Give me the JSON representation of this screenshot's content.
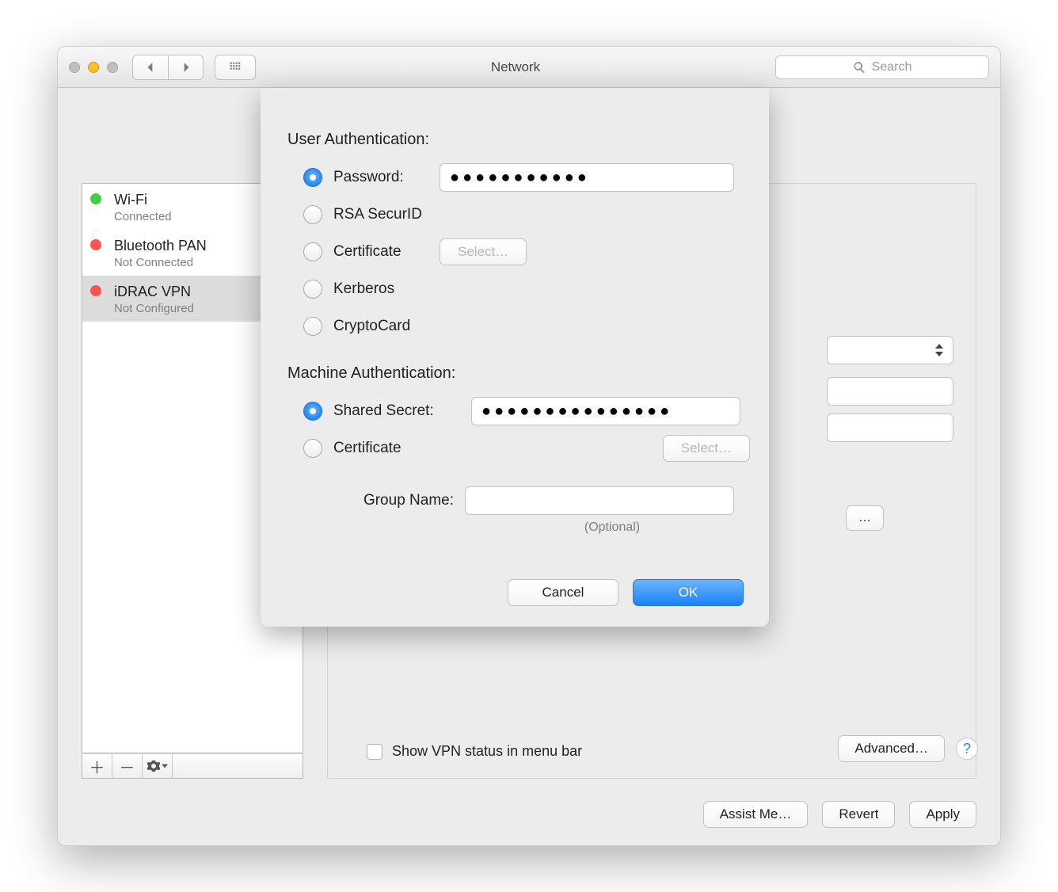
{
  "window": {
    "title": "Network",
    "search_placeholder": "Search"
  },
  "sidebar": {
    "services": [
      {
        "name": "Wi-Fi",
        "status": "Connected",
        "color": "green",
        "selected": false
      },
      {
        "name": "Bluetooth PAN",
        "status": "Not Connected",
        "color": "redb",
        "selected": false
      },
      {
        "name": "iDRAC VPN",
        "status": "Not Configured",
        "color": "redb",
        "selected": true
      }
    ]
  },
  "rightpane": {
    "show_vpn_label": "Show VPN status in menu bar",
    "advanced_label": "Advanced…",
    "help_label": "?"
  },
  "footer": {
    "assist": "Assist Me…",
    "revert": "Revert",
    "apply": "Apply"
  },
  "sheet": {
    "user_auth_heading": "User Authentication:",
    "user_options": [
      {
        "label": "Password:",
        "checked": true
      },
      {
        "label": "RSA SecurID",
        "checked": false
      },
      {
        "label": "Certificate",
        "checked": false
      },
      {
        "label": "Kerberos",
        "checked": false
      },
      {
        "label": "CryptoCard",
        "checked": false
      }
    ],
    "password_value": "●●●●●●●●●●●",
    "cert_select_label": "Select…",
    "machine_auth_heading": "Machine Authentication:",
    "machine_options": [
      {
        "label": "Shared Secret:",
        "checked": true
      },
      {
        "label": "Certificate",
        "checked": false
      }
    ],
    "shared_secret_value": "●●●●●●●●●●●●●●●",
    "machine_cert_select_label": "Select…",
    "group_name_label": "Group Name:",
    "group_name_value": "",
    "group_name_hint": "(Optional)",
    "cancel": "Cancel",
    "ok": "OK"
  }
}
